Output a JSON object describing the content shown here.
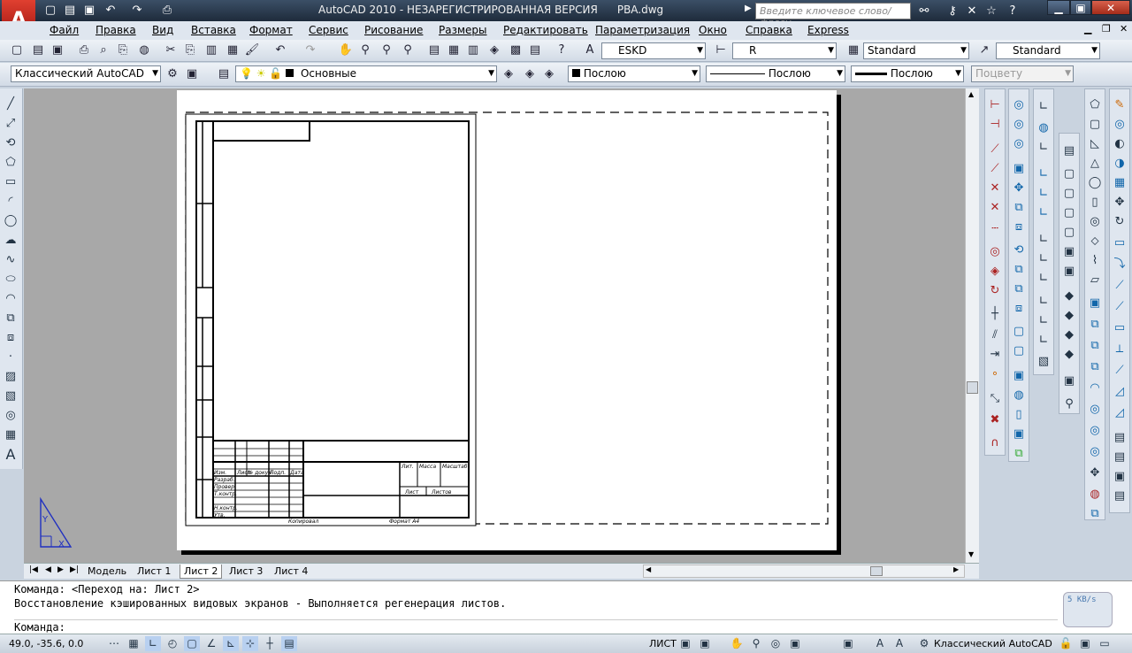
{
  "title": {
    "app": "AutoCAD 2010 - НЕЗАРЕГИСТРИРОВАННАЯ ВЕРСИЯ",
    "file": "PBA.dwg",
    "search_placeholder": "Введите ключевое слово/фразу"
  },
  "menu": [
    "Файл",
    "Правка",
    "Вид",
    "Вставка",
    "Формат",
    "Сервис",
    "Рисование",
    "Размеры",
    "Редактировать",
    "Параметризация",
    "Окно",
    "Справка",
    "Express"
  ],
  "styles": {
    "text": "ESKD",
    "dim": "R",
    "table": "Standard",
    "mleader": "Standard"
  },
  "workspace": "Классический AutoCAD",
  "layer": "Основные",
  "props": {
    "color": "Послою",
    "linetype": "Послою",
    "lineweight": "Послою",
    "plotstyle": "Поцвету"
  },
  "tabs": [
    "Модель",
    "Лист 1",
    "Лист 2",
    "Лист 3",
    "Лист 4"
  ],
  "active_tab": "Лист 2",
  "command": {
    "line1": "Команда:  <Переход на: Лист 2>",
    "line2": "Восстановление кэшированных видовых экранов - Выполняется регенерация листов.",
    "prompt": "Команда:"
  },
  "status": {
    "coords": "49.0, -35.6, 0.0",
    "mode": "ЛИСТ",
    "workspace": "Классический AutoCAD"
  },
  "net_speed": "5 KB/s",
  "stamp": {
    "bottom_left": "Копировал",
    "bottom_right": "Формат A4",
    "cols": [
      "Изм.",
      "Лист",
      "№ докум.",
      "Подп.",
      "Дата"
    ],
    "rows": [
      "Разраб.",
      "Провер.",
      "Т.контр.",
      "Н.контр.",
      "Утв."
    ],
    "right_cells": [
      "Лит.",
      "Масса",
      "Масштаб",
      "Лист",
      "Листов"
    ]
  },
  "colors": {
    "titlebar": "#1e2b3b",
    "ucs": "#2030c0",
    "logo": "#c22a1e"
  }
}
